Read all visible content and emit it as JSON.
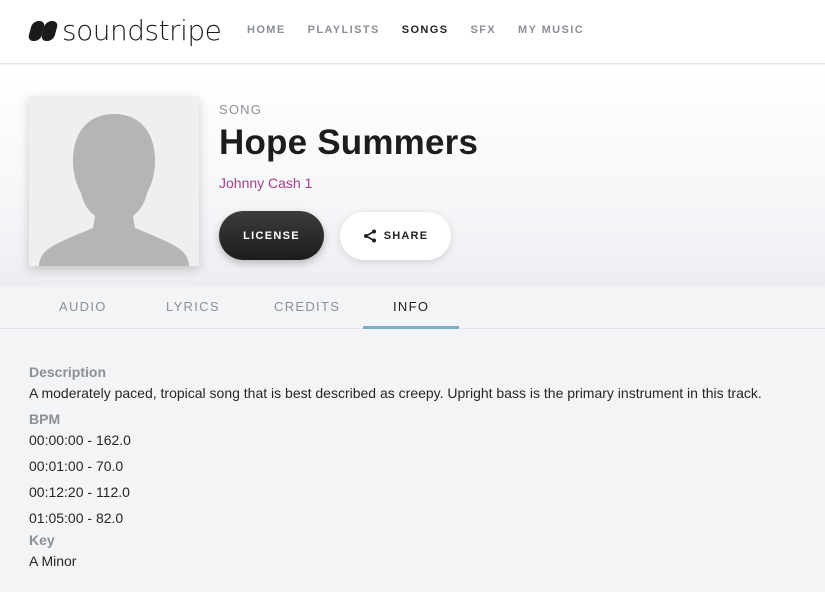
{
  "brand": {
    "name": "soundstripe"
  },
  "nav": {
    "items": [
      {
        "label": "HOME",
        "active": false
      },
      {
        "label": "PLAYLISTS",
        "active": false
      },
      {
        "label": "SONGS",
        "active": true
      },
      {
        "label": "SFX",
        "active": false
      },
      {
        "label": "MY MUSIC",
        "active": false
      }
    ]
  },
  "song": {
    "kind": "SONG",
    "title": "Hope Summers",
    "artist": "Johnny Cash 1",
    "cover_icon": "avatar-silhouette-icon"
  },
  "actions": {
    "license_label": "LICENSE",
    "share_label": "SHARE",
    "share_icon": "share-icon"
  },
  "tabs": [
    {
      "label": "AUDIO",
      "active": false
    },
    {
      "label": "LYRICS",
      "active": false
    },
    {
      "label": "CREDITS",
      "active": false
    },
    {
      "label": "INFO",
      "active": true
    }
  ],
  "info": {
    "description_label": "Description",
    "description": "A moderately paced, tropical song that is best described as creepy. Upright bass is the primary instrument in this track.",
    "bpm_label": "BPM",
    "bpm": [
      "00:00:00 - 162.0",
      "00:01:00 - 70.0",
      "00:12:20 - 112.0",
      "01:05:00 - 82.0"
    ],
    "key_label": "Key",
    "key": "A Minor"
  },
  "colors": {
    "accent_artist": "#a63e8b",
    "tab_underline": "#7aaec9",
    "muted_text": "#8b9097"
  }
}
